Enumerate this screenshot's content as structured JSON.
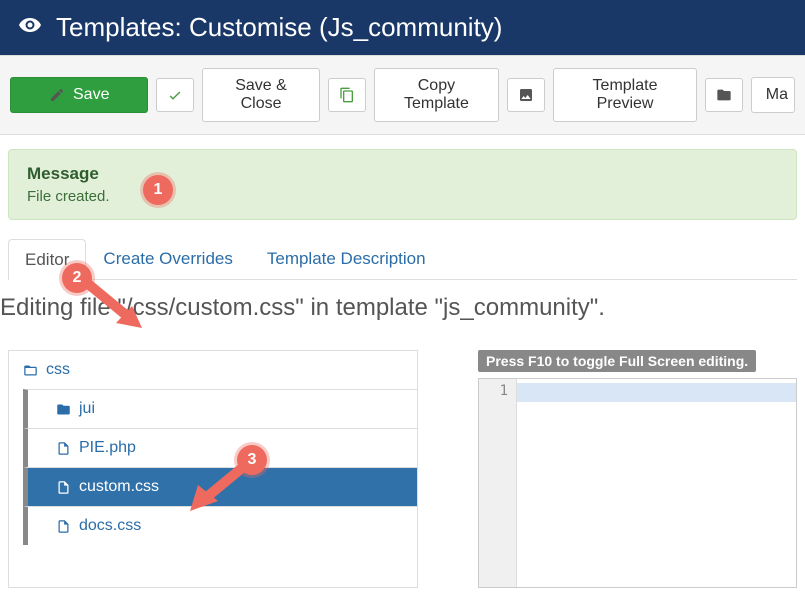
{
  "header": {
    "title": "Templates: Customise (Js_community)"
  },
  "toolbar": {
    "save": "Save",
    "save_close": "Save & Close",
    "copy_template": "Copy Template",
    "template_preview": "Template Preview",
    "manage": "Ma"
  },
  "alert": {
    "heading": "Message",
    "body": "File created."
  },
  "tabs": {
    "editor": "Editor",
    "create_overrides": "Create Overrides",
    "template_description": "Template Description"
  },
  "editing_line": "Editing file \"/css/custom.css\" in template \"js_community\".",
  "tree": {
    "root": "css",
    "items": [
      {
        "type": "folder",
        "label": "jui"
      },
      {
        "type": "file",
        "label": "PIE.php"
      },
      {
        "type": "file",
        "label": "custom.css",
        "selected": true
      },
      {
        "type": "file",
        "label": "docs.css"
      }
    ]
  },
  "editor_hint": "Press F10 to toggle Full Screen editing.",
  "gutter_first_line": "1",
  "annotations": {
    "a1": "1",
    "a2": "2",
    "a3": "3"
  }
}
